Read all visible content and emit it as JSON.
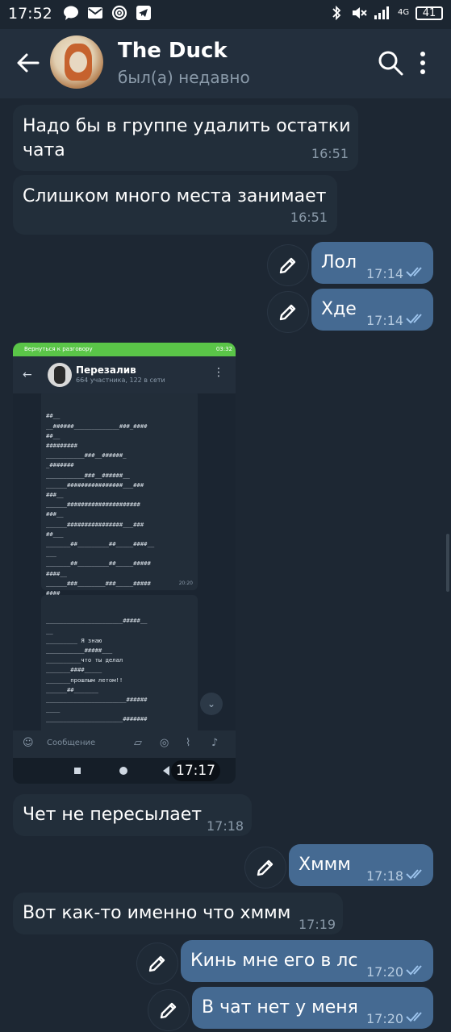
{
  "status_bar": {
    "time": "17:52",
    "battery": "41",
    "network": "4G",
    "icons_left": [
      "chat-bubble-icon",
      "mail-icon",
      "podcast-icon",
      "telegram-icon"
    ],
    "icons_right": [
      "bluetooth-icon",
      "mute-icon",
      "signal-icon",
      "battery-icon"
    ]
  },
  "header": {
    "title": "The Duck",
    "subtitle": "был(а) недавно",
    "icons": [
      "back-arrow-icon",
      "search-icon",
      "more-vertical-icon"
    ]
  },
  "messages": [
    {
      "dir": "in",
      "text_lines": [
        "Надо бы в группе удалить остатки",
        "чата"
      ],
      "time": "16:51"
    },
    {
      "dir": "in",
      "text_lines": [
        "Слишком много места занимает"
      ],
      "time": "16:51"
    },
    {
      "dir": "out",
      "text_lines": [
        "Лол"
      ],
      "time": "17:14",
      "read": true
    },
    {
      "dir": "out",
      "text_lines": [
        "Хде"
      ],
      "time": "17:14",
      "read": true
    },
    {
      "dir": "in",
      "type": "image",
      "time": "17:17"
    },
    {
      "dir": "in",
      "text_lines": [
        "Чет не пересылает"
      ],
      "time": "17:18"
    },
    {
      "dir": "out",
      "text_lines": [
        "Хммм"
      ],
      "time": "17:18",
      "read": true
    },
    {
      "dir": "in",
      "text_lines": [
        "Вот как-то именно что хммм"
      ],
      "time": "17:19"
    },
    {
      "dir": "out",
      "text_lines": [
        "Кинь мне его в лс"
      ],
      "time": "17:20",
      "read": true
    },
    {
      "dir": "out",
      "text_lines": [
        "В чат нет у меня"
      ],
      "time": "17:20",
      "read": true
    }
  ],
  "embedded_screenshot": {
    "call_bar_text": "Вернуться к разговору",
    "call_bar_time": "03:32",
    "group_title": "Перезалив",
    "group_subtitle": "664 участника, 122 в сети",
    "bubble1_lines": [
      "##__",
      "__######_____________###_####",
      "##__",
      "#########",
      "___________###__######_",
      "_#######",
      "___________###__######__",
      "______################___###",
      "###__",
      "______#####################",
      "###__",
      "______################___###",
      "##___",
      "_______##_________##_____####__",
      "___",
      "_______##_________##_____#####",
      "####__",
      "______###________###_____#####",
      "####__"
    ],
    "bubble1_time": "20:20",
    "bubble2_lines": [
      "______________________#####__",
      "__",
      "_________ Я знаю",
      "___________#####___",
      "__________что ты делал",
      "_______####_____",
      "_______прошлым летом!!",
      "______##_______",
      "_______________________######",
      "____",
      "______________________#######",
      "____",
      "____####_____________#######"
    ],
    "input_placeholder": "Сообщение"
  }
}
